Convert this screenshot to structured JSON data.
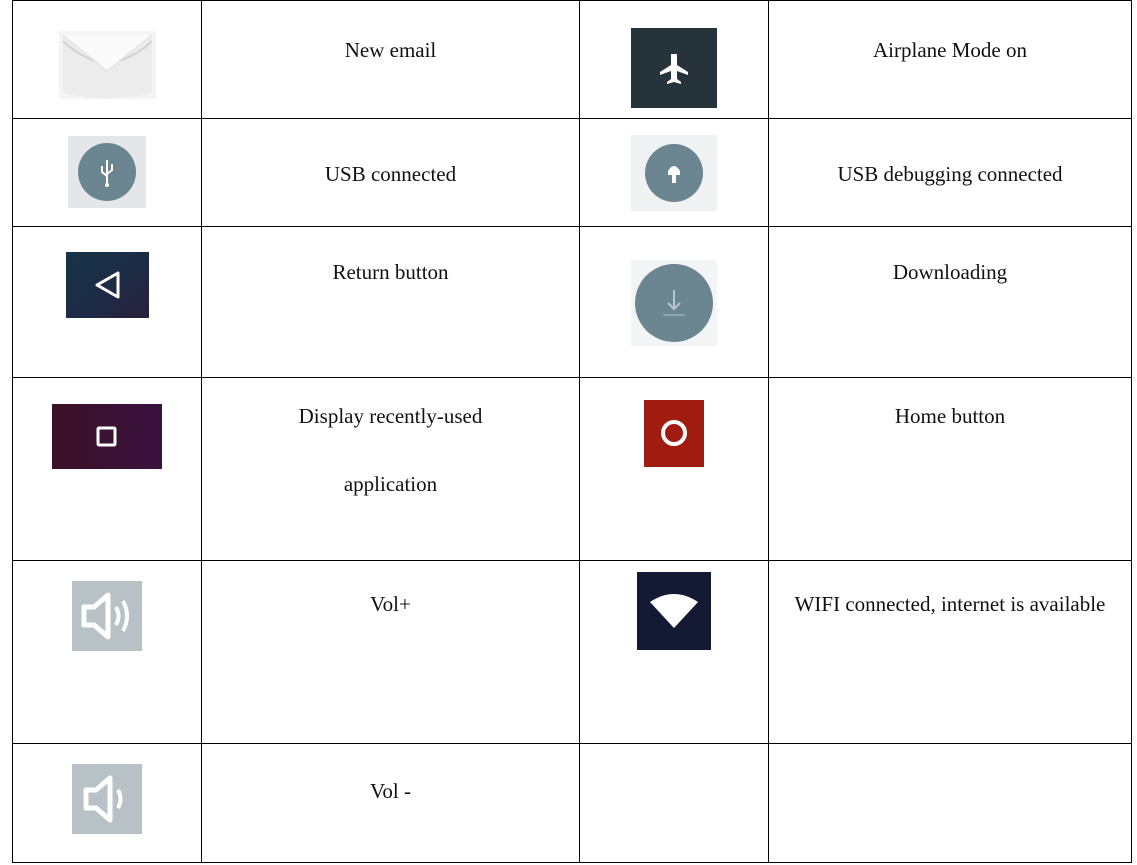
{
  "rows": [
    {
      "left_icon": "envelope-icon",
      "left_label": "New email",
      "right_icon": "airplane-icon",
      "right_label": "Airplane Mode on"
    },
    {
      "left_icon": "usb-icon",
      "left_label": "USB connected",
      "right_icon": "usb-debugging-icon",
      "right_label": "USB debugging connected"
    },
    {
      "left_icon": "back-triangle-icon",
      "left_label": "Return button",
      "right_icon": "download-icon",
      "right_label": "Downloading"
    },
    {
      "left_icon": "recent-apps-square-icon",
      "left_label": "Display recently-used application",
      "right_icon": "home-circle-icon",
      "right_label": "Home button"
    },
    {
      "left_icon": "volume-up-icon",
      "left_label": "Vol+",
      "right_icon": "wifi-icon",
      "right_label": "WIFI connected, internet is available"
    },
    {
      "left_icon": "volume-down-icon",
      "left_label": "Vol -",
      "right_icon": "",
      "right_label": ""
    }
  ],
  "colors": {
    "border": "#000000",
    "status_icon_gray": "#6b8591",
    "airplane_bg": "#27333a",
    "back_bg": "#1e2a45",
    "recent_bg": "#3a1030",
    "home_bg": "#a01c10",
    "wifi_bg": "#141a33",
    "volume_bg": "#b8c2c6"
  }
}
